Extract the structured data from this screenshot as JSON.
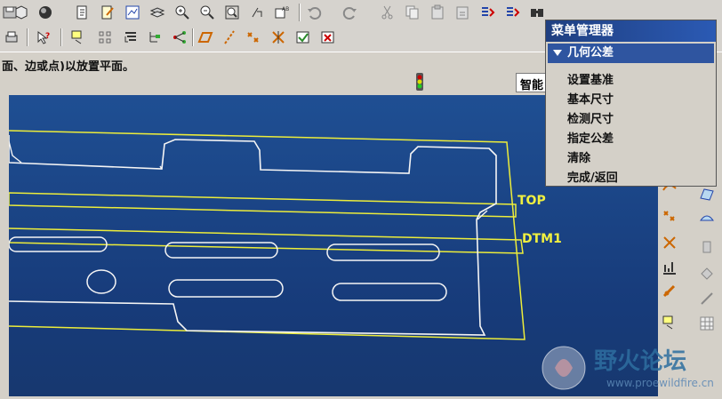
{
  "prompt": {
    "text": "面、边或点)以放置平面。"
  },
  "filter": {
    "value": "智能"
  },
  "menu_manager": {
    "title": "菜单管理器",
    "header": "几何公差",
    "items": [
      "设置基准",
      "基本尺寸",
      "检测尺寸",
      "指定公差",
      "清除",
      "完成/返回"
    ]
  },
  "datum_labels": {
    "top": "TOP",
    "dtm": "DTM1"
  },
  "watermark": {
    "title": "野火论坛",
    "url": "www.proewildfire.cn"
  },
  "toolbar_icons": {
    "row1": [
      "save-icon",
      "hidden-icon",
      "shading-icon",
      "copy-paste-icon",
      "edit-icon",
      "regenerate-icon",
      "layers-icon",
      "zoom-in-icon",
      "zoom-out-icon",
      "zoom-fit-icon",
      "datum-point-icon",
      "rename-icon",
      "undo-icon",
      "redo-icon",
      "cut-icon",
      "copy-icon",
      "paste-icon",
      "paste-special-icon",
      "regen-icon",
      "manager-icon",
      "find-icon",
      "select-icon"
    ],
    "row2": [
      "print-icon",
      "help-icon",
      "note-icon",
      "grid-icon",
      "sort-icon",
      "tree-icon",
      "connect-icon",
      "plane-icon",
      "axis-icon",
      "point-icon",
      "csys-icon",
      "checkbox-icon",
      "close-icon"
    ]
  }
}
